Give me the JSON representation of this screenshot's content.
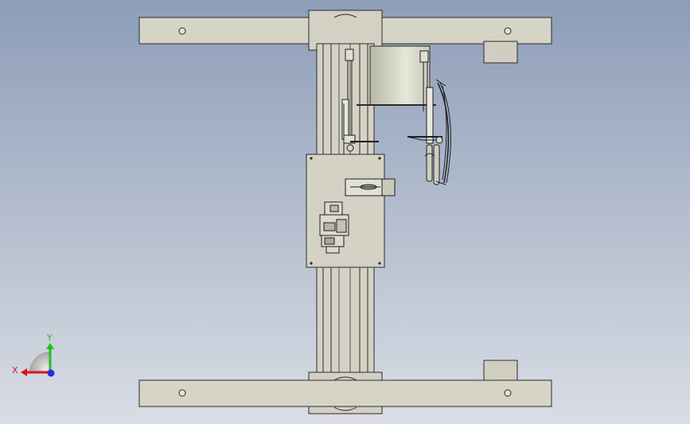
{
  "viewport": {
    "background_top": "#8d9db8",
    "background_bottom": "#d9dde4",
    "part_fill": "#d6d4c6",
    "plate_fill": "#d4d2c5",
    "edge_color": "#2b2b2b",
    "glass_fill": "#c5c5b5"
  },
  "triad": {
    "x_label": "X",
    "y_label": "Y",
    "x_color": "#d8151b",
    "y_color": "#20c020",
    "z_color": "#2a2adf"
  }
}
